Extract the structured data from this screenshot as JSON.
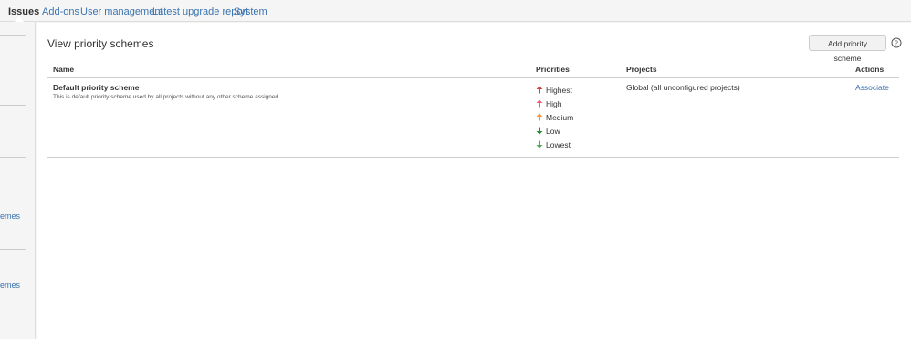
{
  "nav": {
    "tabs": [
      {
        "label": "Issues",
        "active": true
      },
      {
        "label": "Add-ons",
        "active": false
      },
      {
        "label": "User management",
        "active": false
      },
      {
        "label": "Latest upgrade report",
        "active": false
      },
      {
        "label": "System",
        "active": false
      }
    ]
  },
  "sidebar": {
    "links": [
      "emes",
      "emes"
    ]
  },
  "page": {
    "title": "View priority schemes",
    "add_button": "Add priority scheme",
    "help_icon": "help-icon"
  },
  "table": {
    "headers": {
      "name": "Name",
      "priorities": "Priorities",
      "projects": "Projects",
      "actions": "Actions"
    },
    "rows": [
      {
        "name": "Default priority scheme",
        "description": "This is default priority scheme used by all projects without any other scheme assigned",
        "priorities": [
          {
            "label": "Highest",
            "icon": "arrow-up-icon",
            "color": "#d04437"
          },
          {
            "label": "High",
            "icon": "arrow-up-icon",
            "color": "#f15c75"
          },
          {
            "label": "Medium",
            "icon": "arrow-up-icon",
            "color": "#f79232"
          },
          {
            "label": "Low",
            "icon": "arrow-down-icon",
            "color": "#2a8735"
          },
          {
            "label": "Lowest",
            "icon": "arrow-down-icon",
            "color": "#55a557"
          }
        ],
        "projects": "Global (all unconfigured projects)",
        "action": "Associate"
      }
    ]
  },
  "colors": {
    "link": "#3b73af",
    "text": "#333333"
  }
}
